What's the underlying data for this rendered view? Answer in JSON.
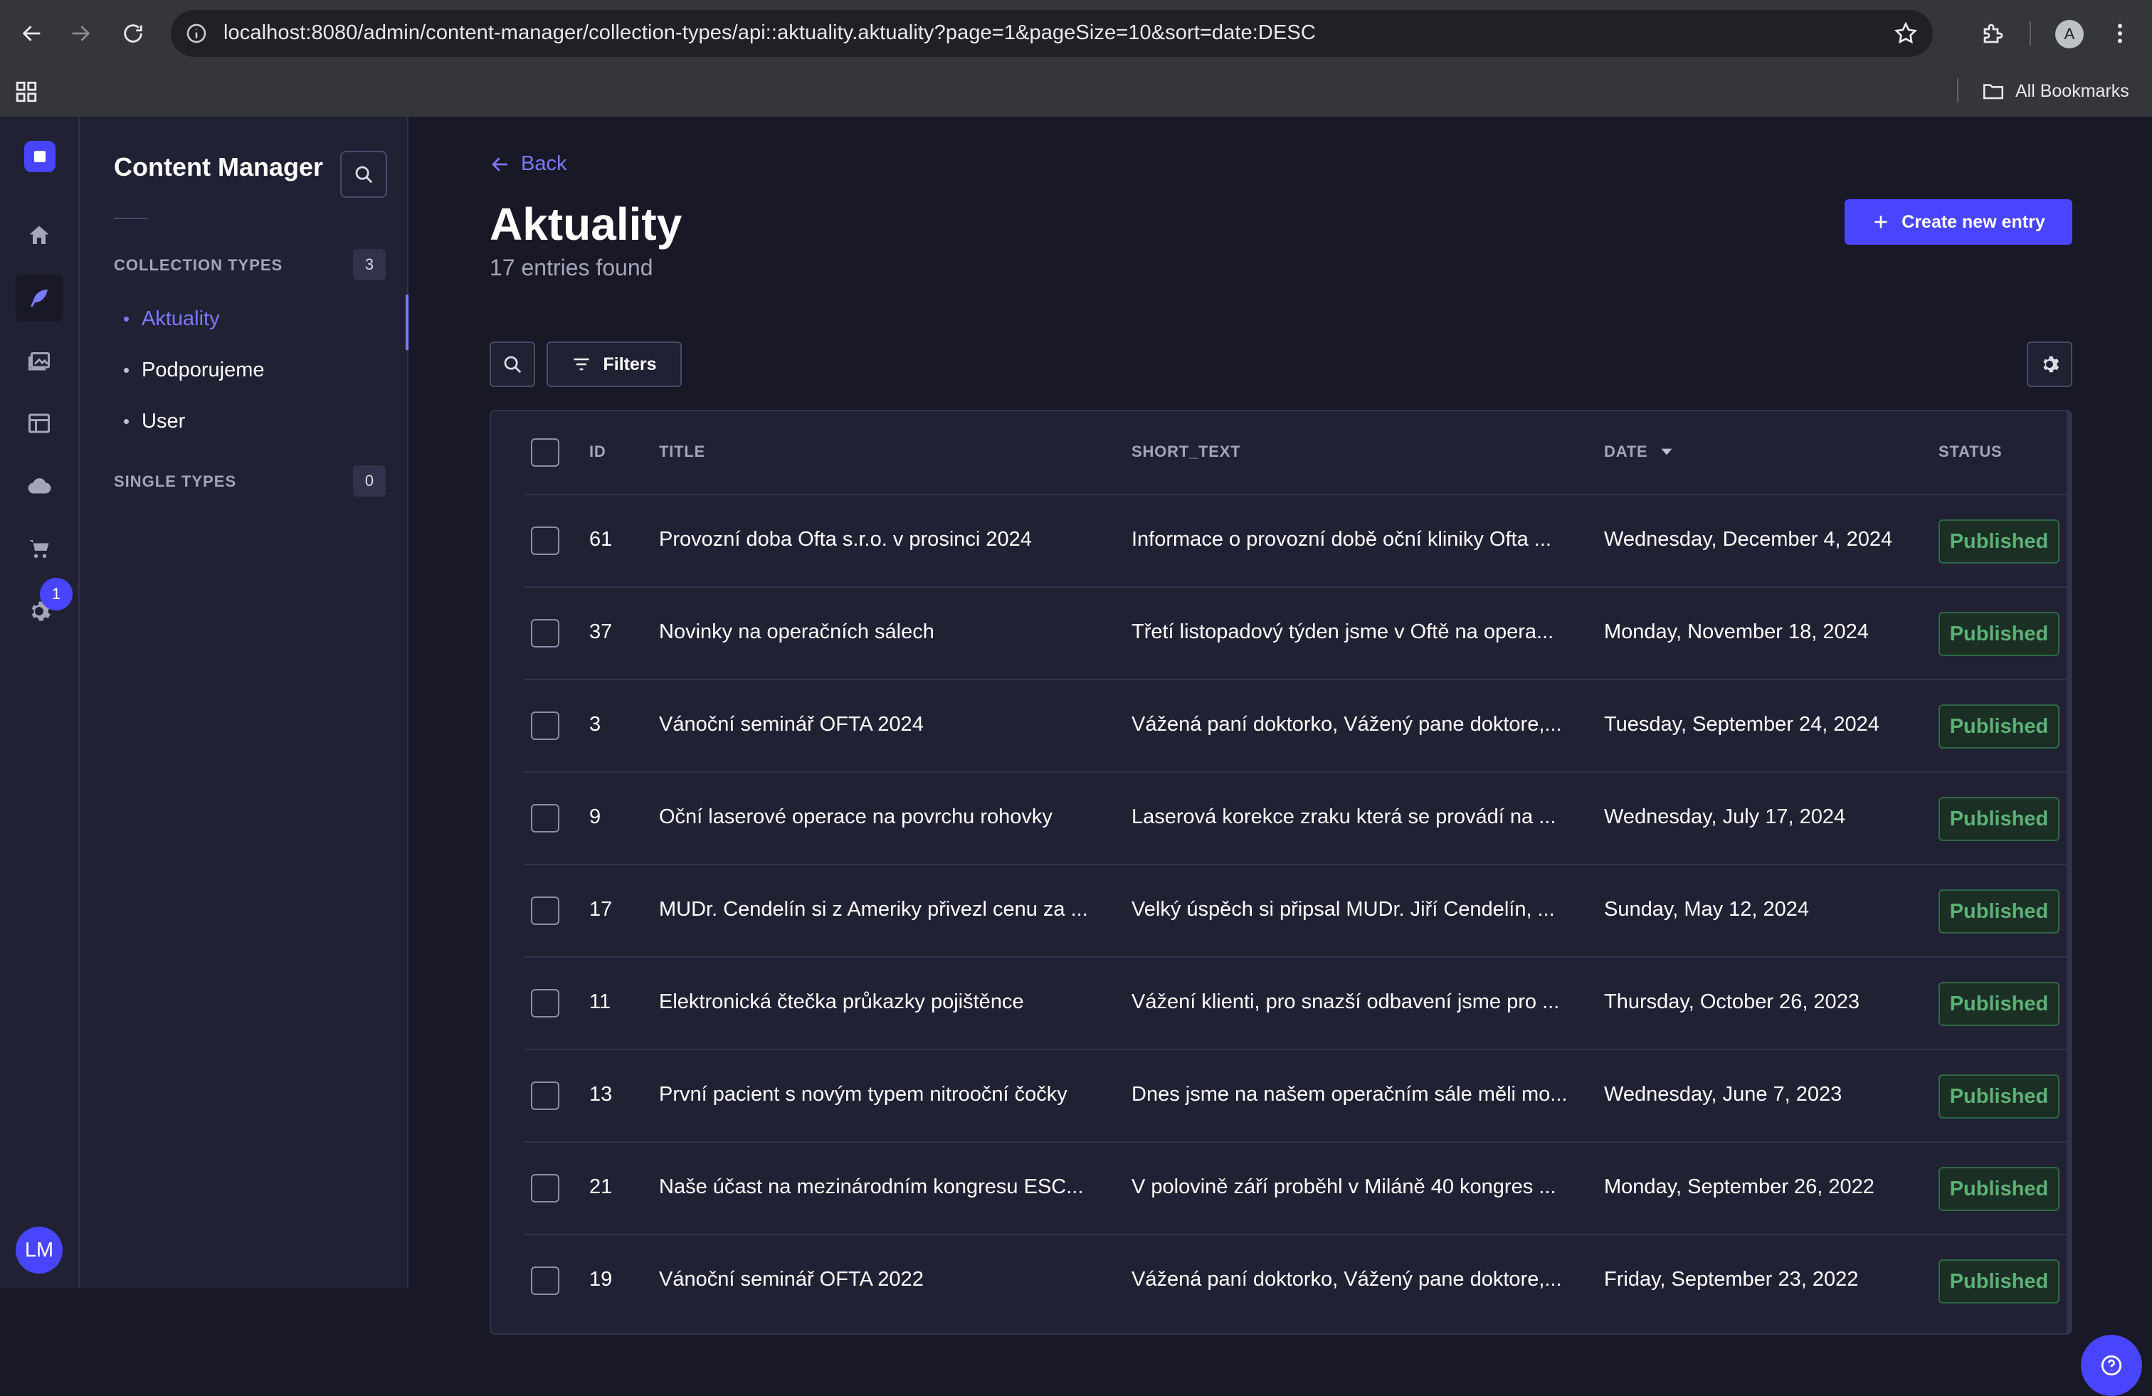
{
  "browser": {
    "url": "localhost:8080/admin/content-manager/collection-types/api::aktuality.aktuality?page=1&pageSize=10&sort=date:DESC",
    "profile_initial": "A",
    "all_bookmarks_label": "All Bookmarks"
  },
  "rail": {
    "badge_count": "1",
    "avatar_initials": "LM"
  },
  "subnav": {
    "title": "Content Manager",
    "collection_types_label": "COLLECTION TYPES",
    "collection_types_count": "3",
    "single_types_label": "SINGLE TYPES",
    "single_types_count": "0",
    "items": [
      {
        "label": "Aktuality"
      },
      {
        "label": "Podporujeme"
      },
      {
        "label": "User"
      }
    ]
  },
  "main": {
    "back_label": "Back",
    "title": "Aktuality",
    "entries_found": "17 entries found",
    "create_label": "Create new entry",
    "filters_label": "Filters"
  },
  "table": {
    "headers": {
      "id": "ID",
      "title": "TITLE",
      "short_text": "SHORT_TEXT",
      "date": "DATE",
      "status": "STATUS"
    },
    "rows": [
      {
        "id": "61",
        "title": "Provozní doba Ofta s.r.o. v prosinci 2024",
        "short_text": "Informace o provozní době oční kliniky Ofta ...",
        "date": "Wednesday, December 4, 2024",
        "status": "Published"
      },
      {
        "id": "37",
        "title": "Novinky na operačních sálech",
        "short_text": "Třetí listopadový týden jsme v Oftě na opera...",
        "date": "Monday, November 18, 2024",
        "status": "Published"
      },
      {
        "id": "3",
        "title": "Vánoční seminář OFTA 2024",
        "short_text": "Vážená paní doktorko, Vážený pane doktore,...",
        "date": "Tuesday, September 24, 2024",
        "status": "Published"
      },
      {
        "id": "9",
        "title": "Oční laserové operace na povrchu rohovky",
        "short_text": "Laserová korekce zraku která se provádí na ...",
        "date": "Wednesday, July 17, 2024",
        "status": "Published"
      },
      {
        "id": "17",
        "title": "MUDr. Cendelín si z Ameriky přivezl cenu za ...",
        "short_text": "Velký úspěch si připsal MUDr. Jiří Cendelín, ...",
        "date": "Sunday, May 12, 2024",
        "status": "Published"
      },
      {
        "id": "11",
        "title": "Elektronická čtečka průkazky pojištěnce",
        "short_text": "Vážení klienti, pro snazší odbavení jsme pro ...",
        "date": "Thursday, October 26, 2023",
        "status": "Published"
      },
      {
        "id": "13",
        "title": "První pacient s novým typem nitrooční čočky",
        "short_text": "Dnes jsme na našem operačním sále měli mo...",
        "date": "Wednesday, June 7, 2023",
        "status": "Published"
      },
      {
        "id": "21",
        "title": "Naše účast na mezinárodním kongresu ESC...",
        "short_text": "V polovině září proběhl v Miláně 40 kongres ...",
        "date": "Monday, September 26, 2022",
        "status": "Published"
      },
      {
        "id": "19",
        "title": "Vánoční seminář OFTA 2022",
        "short_text": "Vážená paní doktorko, Vážený pane doktore,...",
        "date": "Friday, September 23, 2022",
        "status": "Published"
      }
    ]
  }
}
